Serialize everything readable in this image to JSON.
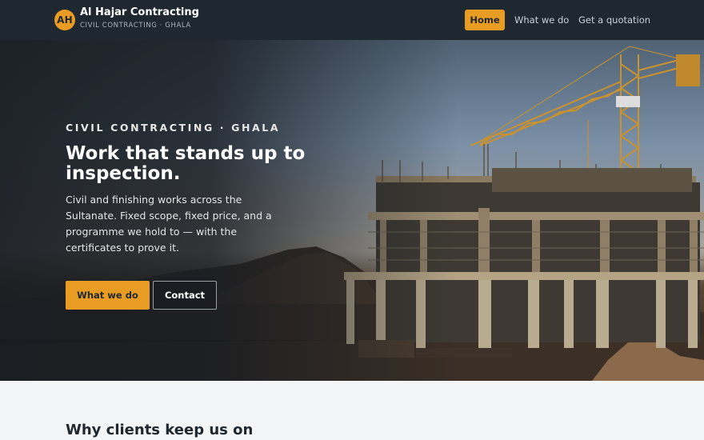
{
  "header": {
    "logo_initials": "AH",
    "brand_name": "Al Hajar Contracting",
    "brand_tagline": "CIVIL CONTRACTING · GHALA",
    "nav": {
      "home": "Home",
      "what_we_do": "What we do",
      "quotation": "Get a quotation"
    }
  },
  "hero": {
    "eyebrow": "CIVIL CONTRACTING · GHALA",
    "headline": "Work that stands up to inspection.",
    "lede": "Civil and finishing works across the Sultanate. Fixed scope, fixed price, and a programme we hold to — with the certificates to prove it.",
    "primary_button": "What we do",
    "secondary_button": "Contact"
  },
  "next_section": {
    "title": "Why clients keep us on"
  },
  "colors": {
    "header_bg": "#1f2830",
    "accent": "#e89c24",
    "page_bg": "#f4f5f6"
  }
}
